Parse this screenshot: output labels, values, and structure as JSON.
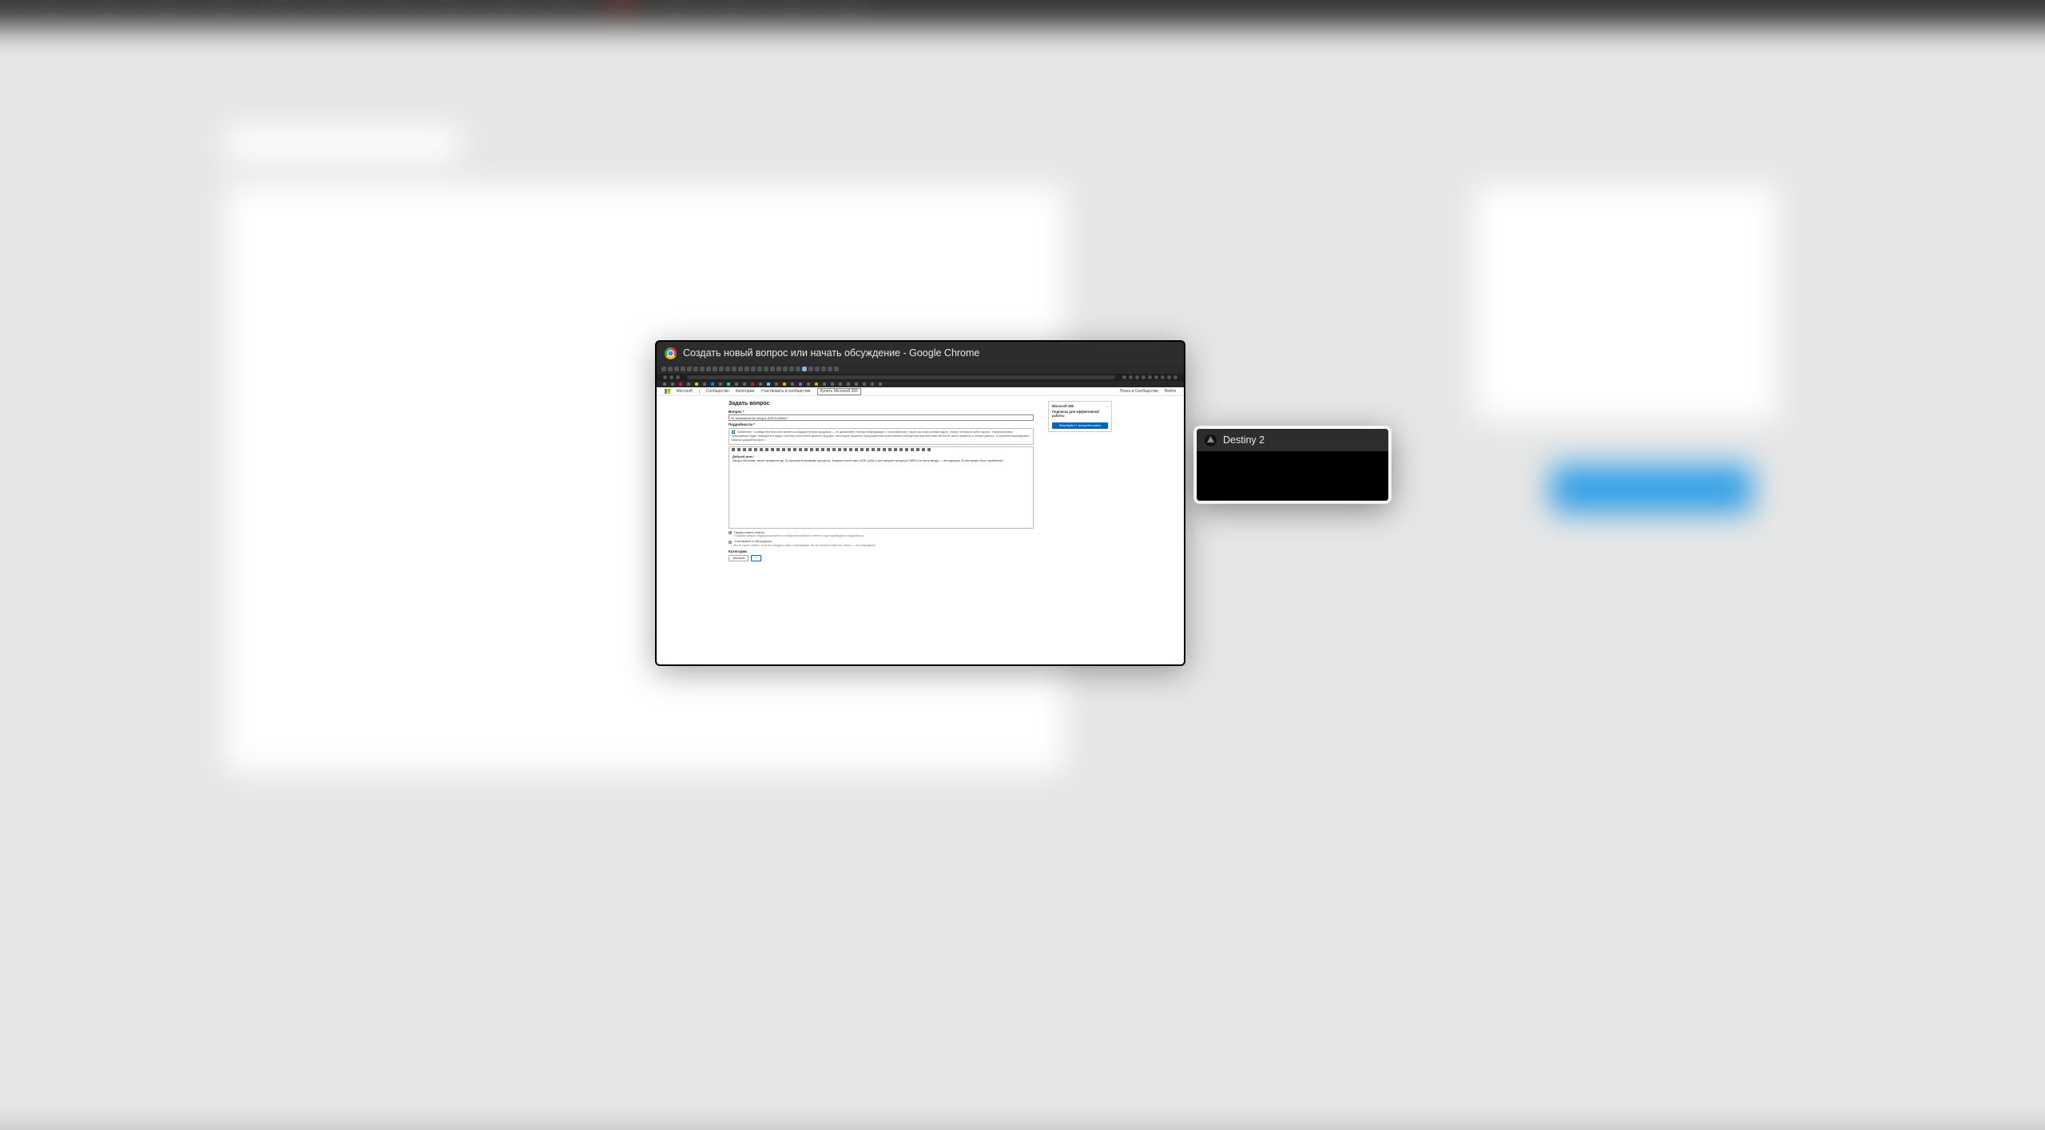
{
  "switcher": {
    "windows": [
      {
        "title": "Создать новый вопрос или начать обсуждение - Google Chrome",
        "app": "chrome",
        "selected": false
      },
      {
        "title": "Destiny 2",
        "app": "destiny",
        "selected": true
      }
    ]
  },
  "chrome_page": {
    "header": {
      "brand": "Microsoft",
      "community": "Сообщество",
      "nav1": "Категории",
      "nav2": "Участвовать в сообществе",
      "nav3": "Купить Microsoft 365",
      "search_hint": "Поиск в Сообществе",
      "signin": "Войти"
    },
    "title": "Задать вопрос",
    "question_label": "Вопрос *",
    "question_value": "не запоминается вход в AOE4 edition?",
    "details_label": "Подробности *",
    "privacy_note": "Заявление. Сообщество Microsoft является общедоступным форумом — не добавляйте личную информацию о пользователях, такую как электронный адрес, номер телефона либо пароль. Указанная вами информация будет немедленно видна любому посетителю данного форума. Некоторые решения, предложенные участниками сообщества или агентами Microsoft, могут привести к потере данных. Сохраняйте/архивируйте важные документы/фото.",
    "editor_heading": "Добрый день!",
    "editor_body": "Запуск Windows, через примерно до 15 русскую в игровому процессу. Запуски после авто AOE (x64) я при запуске процессе HDR и не могу вводу — нет курсора. В чём может быть проблема?",
    "radio1_label": "Предоставить ответы",
    "radio1_hint": "Создайте вопрос. Модераторы/агенты сообщества публично ответят, когда подтвердятся подробности.",
    "radio2_label": "Участвовать в обсуждении",
    "radio2_hint": "Вы не ищете ответы, а хотите обсудить тему с участниками. Вы не сможете отметить ответы — это обсуждение.",
    "categories_label": "Категории",
    "chip_windows": "Windows",
    "chip_add": "+",
    "sidebar": {
      "brand": "Microsoft 365",
      "close": "×",
      "lead": "Подписка для эффективной работы",
      "button": "Попробуйте 1 месяц бесплатно"
    }
  }
}
